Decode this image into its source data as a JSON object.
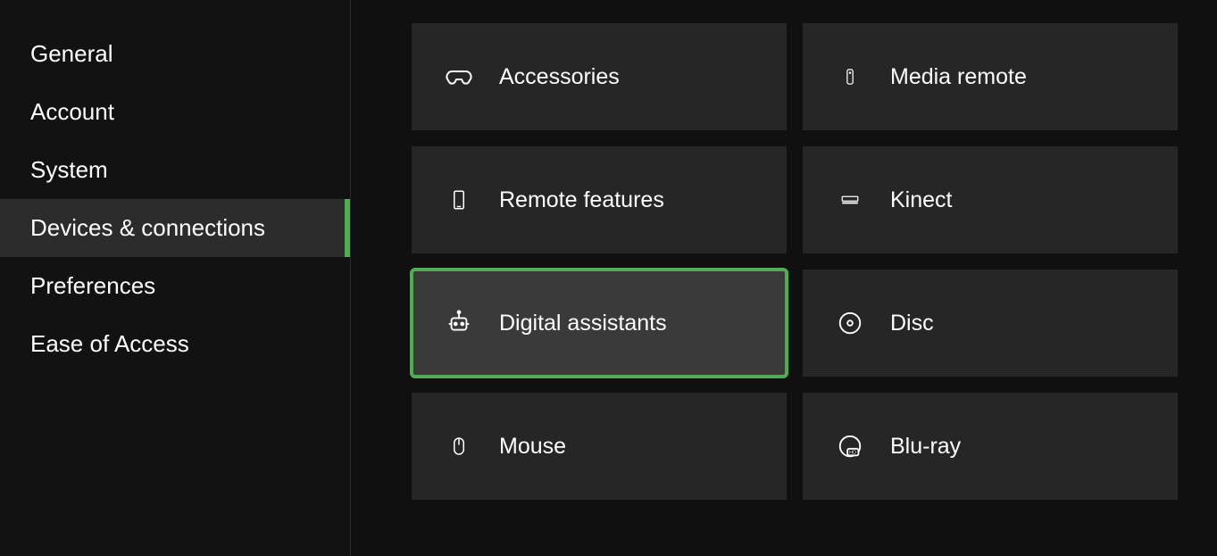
{
  "sidebar": {
    "items": [
      {
        "label": "General",
        "active": false
      },
      {
        "label": "Account",
        "active": false
      },
      {
        "label": "System",
        "active": false
      },
      {
        "label": "Devices & connections",
        "active": true
      },
      {
        "label": "Preferences",
        "active": false
      },
      {
        "label": "Ease of Access",
        "active": false
      }
    ]
  },
  "tiles": [
    {
      "label": "Accessories",
      "icon": "controller-icon",
      "selected": false
    },
    {
      "label": "Media remote",
      "icon": "remote-icon",
      "selected": false
    },
    {
      "label": "Remote features",
      "icon": "phone-icon",
      "selected": false
    },
    {
      "label": "Kinect",
      "icon": "kinect-icon",
      "selected": false
    },
    {
      "label": "Digital assistants",
      "icon": "robot-icon",
      "selected": true
    },
    {
      "label": "Disc",
      "icon": "disc-icon",
      "selected": false
    },
    {
      "label": "Mouse",
      "icon": "mouse-icon",
      "selected": false
    },
    {
      "label": "Blu-ray",
      "icon": "bluray-icon",
      "selected": false
    }
  ]
}
